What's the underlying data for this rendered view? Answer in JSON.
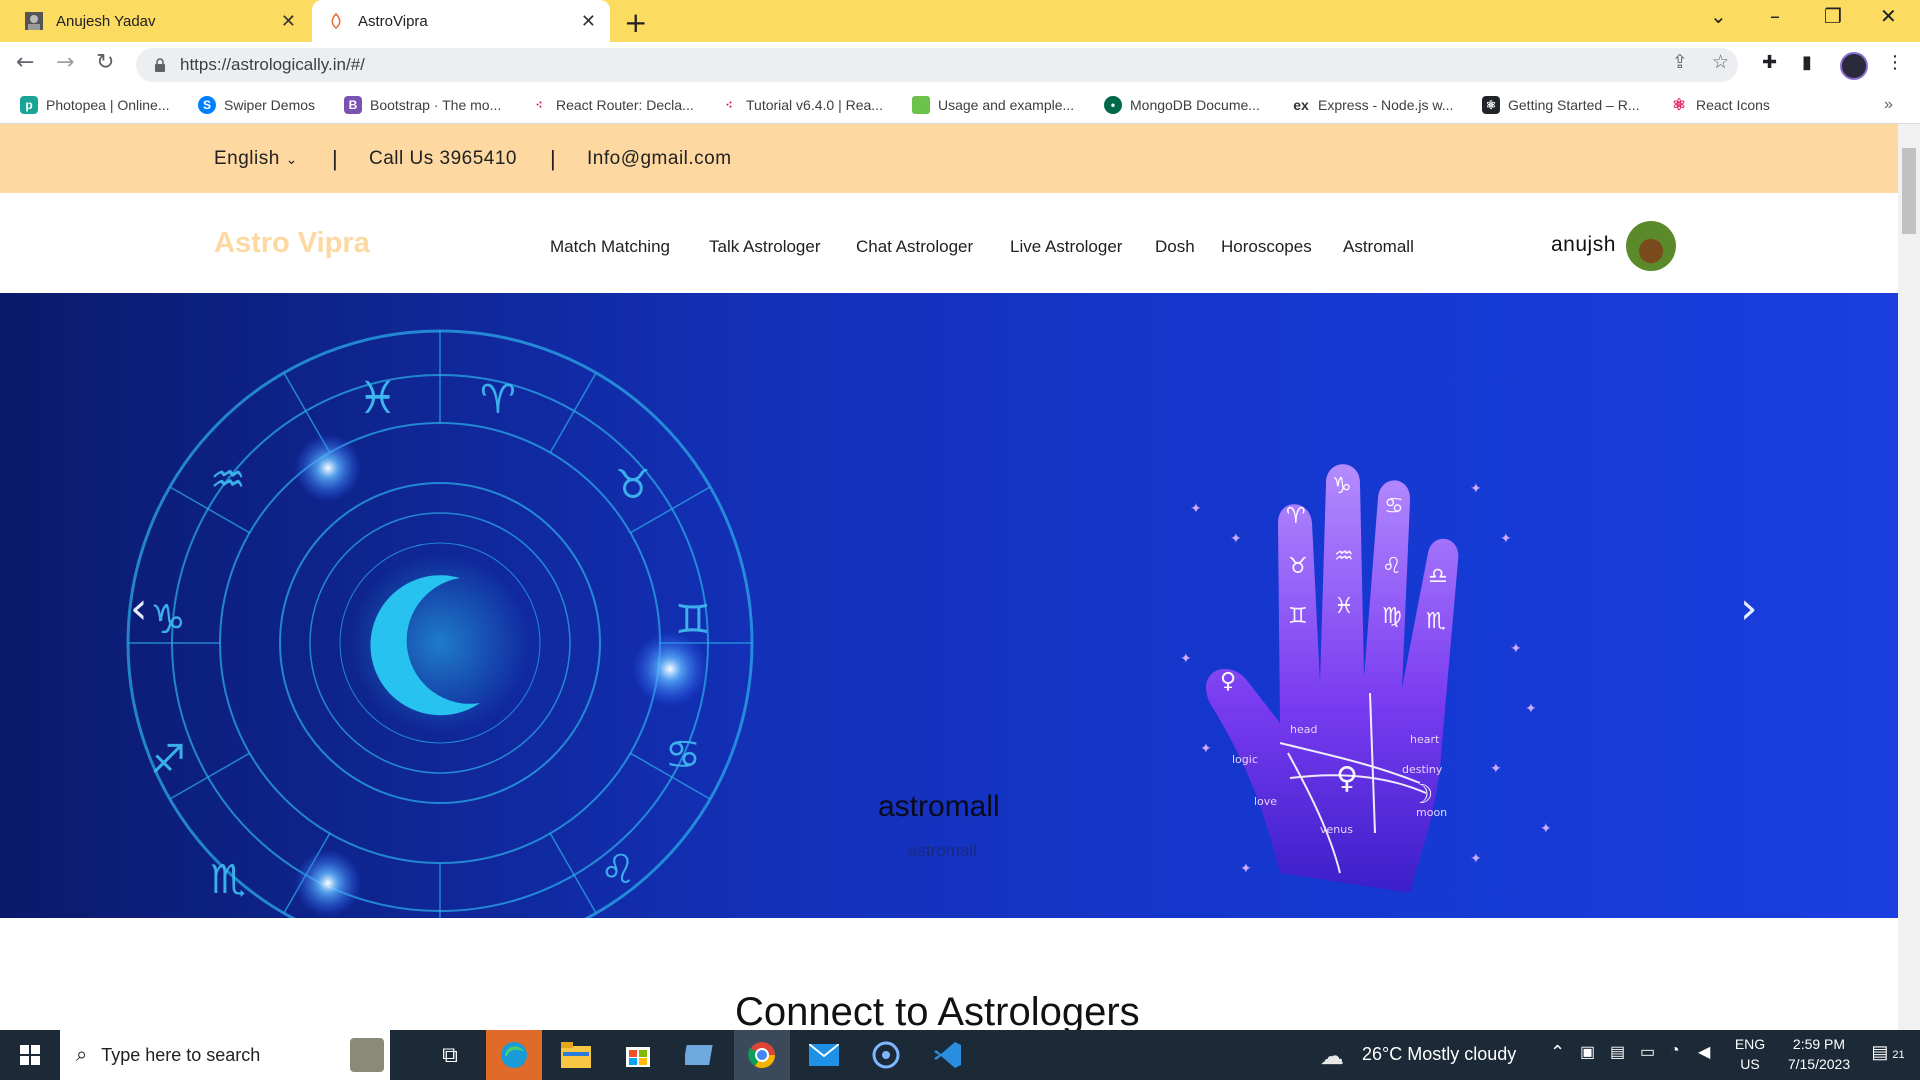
{
  "browser": {
    "tabs": [
      {
        "title": "Anujesh Yadav",
        "active": false
      },
      {
        "title": "AstroVipra",
        "active": true
      }
    ],
    "address": {
      "url": "https://astrologically.in/#/"
    },
    "bookmarks": [
      {
        "label": "Photopea | Online...",
        "icon": "photopea-icon",
        "color": "#18a497"
      },
      {
        "label": "Swiper Demos",
        "icon": "swiper-icon",
        "color": "#0080ff"
      },
      {
        "label": "Bootstrap · The mo...",
        "icon": "bootstrap-icon",
        "color": "#7952b3"
      },
      {
        "label": "React Router: Decla...",
        "icon": "react-router-icon",
        "color": "#d0021b"
      },
      {
        "label": "Tutorial v6.4.0 | Rea...",
        "icon": "react-router-icon",
        "color": "#d0021b"
      },
      {
        "label": "Usage and example...",
        "icon": "node-icon",
        "color": "#6cc24a"
      },
      {
        "label": "MongoDB Docume...",
        "icon": "mongodb-icon",
        "color": "#00684a"
      },
      {
        "label": "Express - Node.js w...",
        "icon": "express-icon",
        "color": "#333333"
      },
      {
        "label": "Getting Started – R...",
        "icon": "redux-icon",
        "color": "#20232a"
      },
      {
        "label": "React Icons",
        "icon": "react-icon",
        "color": "#e91e63"
      }
    ]
  },
  "topbar": {
    "language": "English",
    "phone": "Call Us 3965410",
    "email": "Info@gmail.com"
  },
  "header": {
    "logo": "Astro Vipra",
    "menu": [
      "Match Matching",
      "Talk Astrologer",
      "Chat Astrologer",
      "Live Astrologer",
      "Dosh",
      "Horoscopes",
      "Astromall"
    ],
    "user": "anujsh"
  },
  "hero": {
    "title": "astromall",
    "subtitle": "astromall"
  },
  "section": {
    "heading": "Connect to Astrologers"
  },
  "taskbar": {
    "search_placeholder": "Type here to search",
    "weather": "26°C  Mostly cloudy",
    "lang_top": "ENG",
    "lang_bottom": "US",
    "time": "2:59 PM",
    "date": "7/15/2023",
    "notifications": "21"
  },
  "colors": {
    "tab_strip": "#fbdb60",
    "topbar": "#fdd8a1",
    "logo": "#fdd8a1",
    "hero": "#1538d0",
    "taskbar": "#1b2a36"
  }
}
